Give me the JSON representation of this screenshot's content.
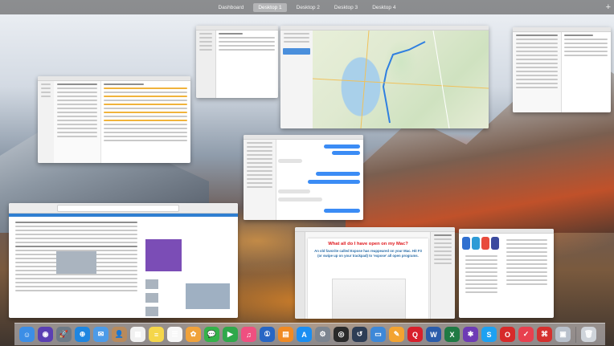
{
  "spaces": {
    "tabs": [
      {
        "label": "Dashboard",
        "active": false
      },
      {
        "label": "Desktop 1",
        "active": true
      },
      {
        "label": "Desktop 2",
        "active": false
      },
      {
        "label": "Desktop 3",
        "active": false
      },
      {
        "label": "Desktop 4",
        "active": false
      }
    ],
    "add_label": "+"
  },
  "pages_doc": {
    "title": "What all do I have open on my Mac?",
    "body": "An old favorite called Expose has reappeared on your Mac. Hit F3 (or swipe up on your trackpad) to 'expose' all open programs."
  },
  "dock": {
    "icons": [
      {
        "name": "finder-icon",
        "color": "#3c8ee6",
        "glyph": "☺"
      },
      {
        "name": "siri-icon",
        "color": "#5b3fb3",
        "glyph": "◉"
      },
      {
        "name": "launchpad-icon",
        "color": "#6d7a86",
        "glyph": "🚀"
      },
      {
        "name": "safari-icon",
        "color": "#1f86e0",
        "glyph": "⊕"
      },
      {
        "name": "mail-icon",
        "color": "#4c9be8",
        "glyph": "✉"
      },
      {
        "name": "contacts-icon",
        "color": "#b88a5c",
        "glyph": "👤"
      },
      {
        "name": "calendar-icon",
        "color": "#f1f1f1",
        "glyph": "▦"
      },
      {
        "name": "notes-icon",
        "color": "#f5d64a",
        "glyph": "≡"
      },
      {
        "name": "reminders-icon",
        "color": "#f7f7f7",
        "glyph": "☰"
      },
      {
        "name": "photos-icon",
        "color": "#f0a23b",
        "glyph": "✿"
      },
      {
        "name": "messages-icon",
        "color": "#35b24a",
        "glyph": "💬"
      },
      {
        "name": "facetime-icon",
        "color": "#2fa84b",
        "glyph": "▶"
      },
      {
        "name": "itunes-icon",
        "color": "#ef5080",
        "glyph": "♫"
      },
      {
        "name": "onepassword-icon",
        "color": "#2766c4",
        "glyph": "①"
      },
      {
        "name": "books-icon",
        "color": "#f08a24",
        "glyph": "▤"
      },
      {
        "name": "app-store-icon",
        "color": "#1a8ef2",
        "glyph": "A"
      },
      {
        "name": "system-preferences-icon",
        "color": "#7c8590",
        "glyph": "⚙"
      },
      {
        "name": "keychain-icon",
        "color": "#2a2a2a",
        "glyph": "◎"
      },
      {
        "name": "time-machine-icon",
        "color": "#2d3d55",
        "glyph": "↺"
      },
      {
        "name": "keynote-icon",
        "color": "#3d88d8",
        "glyph": "▭"
      },
      {
        "name": "pages-icon",
        "color": "#f3a331",
        "glyph": "✎"
      },
      {
        "name": "quicken-icon",
        "color": "#d71f2b",
        "glyph": "Q"
      },
      {
        "name": "word-icon",
        "color": "#2a5caa",
        "glyph": "W"
      },
      {
        "name": "excel-icon",
        "color": "#1f7a44",
        "glyph": "X"
      },
      {
        "name": "slack-icon",
        "color": "#6e3bb5",
        "glyph": "✱"
      },
      {
        "name": "skype-icon",
        "color": "#1da1f2",
        "glyph": "S"
      },
      {
        "name": "opera-icon",
        "color": "#d72a2a",
        "glyph": "O"
      },
      {
        "name": "pocket-icon",
        "color": "#e8404f",
        "glyph": "✓"
      },
      {
        "name": "acrobat-icon",
        "color": "#d5302e",
        "glyph": "⌘"
      },
      {
        "name": "preview-icon",
        "color": "#b9c1cc",
        "glyph": "▣"
      },
      {
        "name": "trash-icon",
        "color": "#cfd4da",
        "glyph": "🗑"
      }
    ]
  }
}
